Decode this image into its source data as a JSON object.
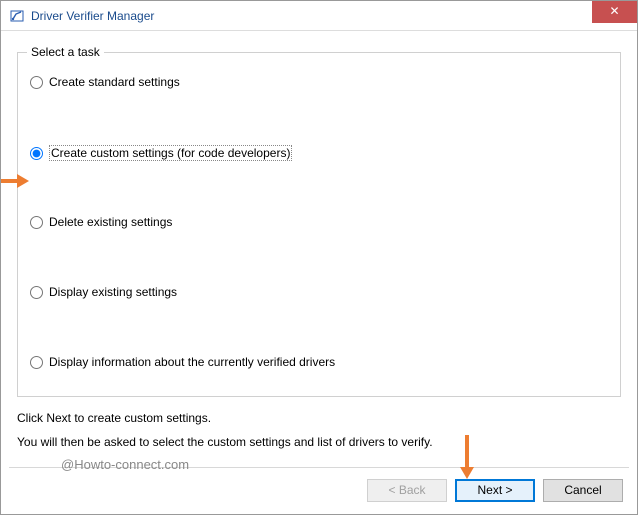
{
  "window": {
    "title": "Driver Verifier Manager",
    "close_glyph": "✕"
  },
  "group": {
    "legend": "Select a task",
    "options": {
      "opt1": "Create standard settings",
      "opt2": "Create custom settings (for code developers)",
      "opt3": "Delete existing settings",
      "opt4": "Display existing settings",
      "opt5": "Display information about the currently verified drivers"
    },
    "selected": "opt2"
  },
  "info": {
    "line1": "Click Next to create custom settings.",
    "line2": "You will then be asked to select the custom settings and list of drivers to verify."
  },
  "buttons": {
    "back": "< Back",
    "next": "Next >",
    "cancel": "Cancel"
  },
  "watermark": "@Howto-connect.com",
  "annotation_color": "#ed7d31"
}
